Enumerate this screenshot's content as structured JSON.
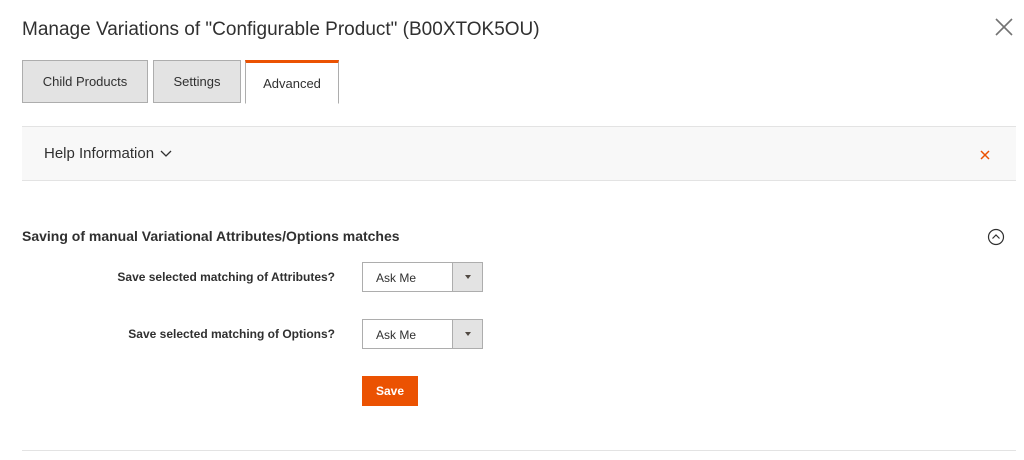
{
  "modal": {
    "title": "Manage Variations of \"Configurable Product\" (B00XTOK5OU)",
    "close_icon": "close-icon"
  },
  "tabs": [
    {
      "label": "Child Products",
      "active": false
    },
    {
      "label": "Settings",
      "active": false
    },
    {
      "label": "Advanced",
      "active": true
    }
  ],
  "help": {
    "label": "Help Information",
    "toggle_icon": "chevron-down-icon",
    "close_icon": "close-icon"
  },
  "section": {
    "title": "Saving of manual Variational Attributes/Options matches",
    "collapse_icon": "chevron-up-circle-icon",
    "fields": [
      {
        "label": "Save selected matching of Attributes?",
        "value": "Ask Me"
      },
      {
        "label": "Save selected matching of Options?",
        "value": "Ask Me"
      }
    ],
    "save_label": "Save"
  },
  "colors": {
    "accent": "#eb5202",
    "text": "#303030",
    "tab_bg": "#e3e3e3",
    "help_bg": "#f8f8f8"
  }
}
